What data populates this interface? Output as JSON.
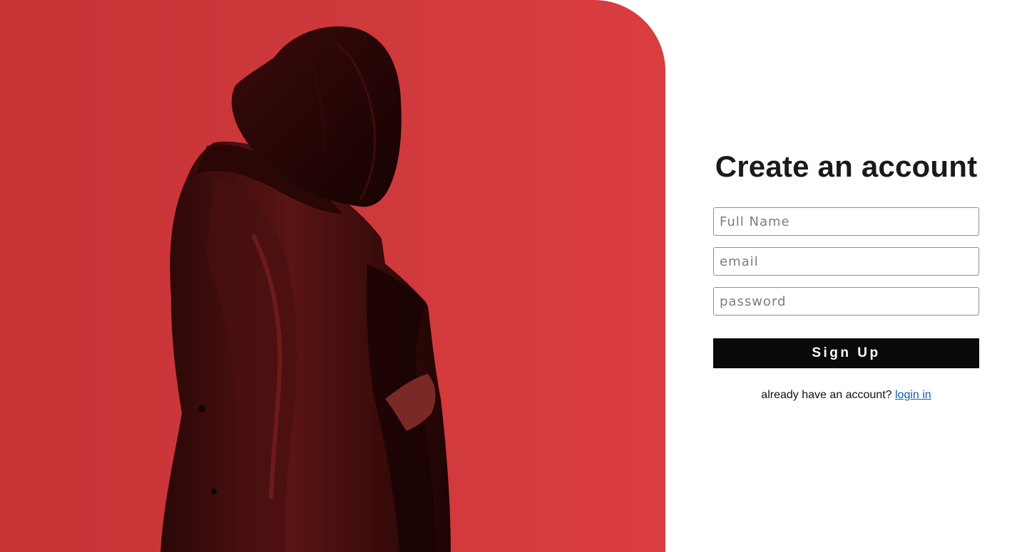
{
  "hero": {
    "image_icon": "woman-in-leather-coat-photo",
    "background_color": "#d13b3d"
  },
  "form": {
    "title": "Create an account",
    "full_name": {
      "placeholder": "Full Name",
      "value": ""
    },
    "email": {
      "placeholder": "email",
      "value": ""
    },
    "password": {
      "placeholder": "password",
      "value": ""
    },
    "signup_label": "Sign Up",
    "footer_text": "already have an account?",
    "login_link_label": "login in"
  },
  "colors": {
    "accent": "#d13b3d",
    "button": "#0a0a0a",
    "link": "#0b5fb5"
  }
}
